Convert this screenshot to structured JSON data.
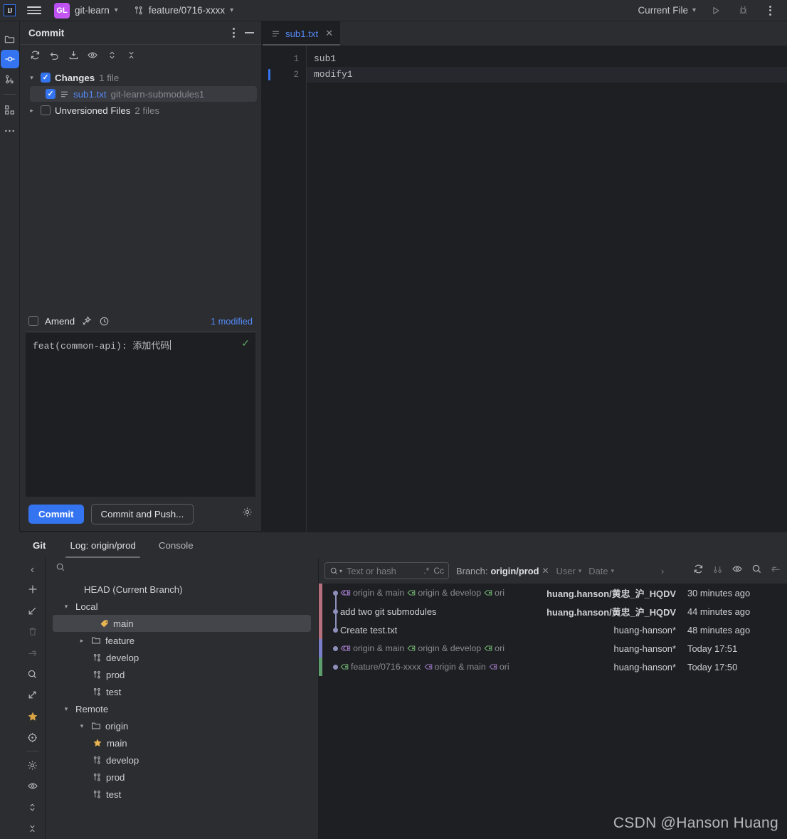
{
  "titlebar": {
    "logo": "IJ",
    "menu_icon": "hamburger-menu-icon",
    "project_badge": "GL",
    "project_name": "git-learn",
    "branch_icon": "git-branch-icon",
    "branch_name": "feature/0716-xxxx",
    "run_config": "Current File",
    "run_icon": "run-icon",
    "debug_icon": "debug-icon",
    "more_icon": "more-vertical-icon"
  },
  "left_stripe": {
    "items": [
      {
        "name": "project-tool-icon",
        "icon": "folder"
      },
      {
        "name": "commit-tool-icon",
        "icon": "commit",
        "active": true
      },
      {
        "name": "pull-requests-icon",
        "icon": "branch"
      },
      {
        "name": "structure-icon",
        "icon": "structure"
      },
      {
        "name": "more-tools-icon",
        "icon": "ellipsis"
      }
    ]
  },
  "commit_panel": {
    "title": "Commit",
    "options_icon": "more-vertical-icon",
    "minimize_icon": "minimize-icon",
    "toolbar": [
      {
        "name": "refresh-changes-icon"
      },
      {
        "name": "rollback-icon"
      },
      {
        "name": "shelve-icon"
      },
      {
        "name": "show-diff-icon"
      },
      {
        "name": "expand-collapse-icon"
      },
      {
        "name": "collapse-all-icon"
      }
    ],
    "tree": {
      "changes": {
        "label": "Changes",
        "count": "1 file",
        "checked": true,
        "expanded": true
      },
      "file": {
        "name": "sub1.txt",
        "path": "git-learn-submodules1",
        "checked": true,
        "selected": true,
        "icon": "text-file-icon"
      },
      "unversioned": {
        "label": "Unversioned Files",
        "count": "2 files",
        "checked": false,
        "expanded": false
      }
    },
    "amend": {
      "label": "Amend",
      "checked": false,
      "ai_icon": "ai-commit-message-icon",
      "history_icon": "commit-history-icon"
    },
    "modified_status": "1 modified",
    "message_value": "feat(common-api): 添加代码",
    "message_ok_icon": "check-icon",
    "commit_button": "Commit",
    "commit_push_button": "Commit and Push...",
    "settings_icon": "gear-icon"
  },
  "editor": {
    "tab": {
      "icon": "text-file-icon",
      "name": "sub1.txt",
      "close_icon": "close-icon"
    },
    "lines": [
      {
        "num": "1",
        "text": "sub1",
        "modified": false,
        "current": false
      },
      {
        "num": "2",
        "text": "modify1",
        "modified": true,
        "current": true
      }
    ]
  },
  "git_window": {
    "title": "Git",
    "tabs": [
      {
        "label": "Log: origin/prod",
        "active": true
      },
      {
        "label": "Console",
        "active": false
      }
    ],
    "side_icons": [
      {
        "name": "add-icon"
      },
      {
        "name": "checkout-icon"
      },
      {
        "name": "delete-icon",
        "dim": true
      },
      {
        "name": "rebase-icon",
        "dim": true
      },
      {
        "name": "search-icon"
      },
      {
        "name": "merge-icon"
      },
      {
        "name": "favorite-star-icon",
        "accent": "#d9a343"
      },
      {
        "name": "navigate-icon"
      },
      {
        "name": "settings-gear-icon"
      },
      {
        "name": "show-preview-icon"
      },
      {
        "name": "expand-all-icon"
      },
      {
        "name": "collapse-all-icon"
      }
    ],
    "branch_search_icon": "search-icon",
    "branch_tree": [
      {
        "label": "HEAD (Current Branch)",
        "indent": 1,
        "icon": "none",
        "twisty": ""
      },
      {
        "label": "Local",
        "indent": 0,
        "icon": "none",
        "twisty": "v"
      },
      {
        "label": "main",
        "indent": 2,
        "icon": "tag-yellow",
        "twisty": "",
        "selected": true
      },
      {
        "label": "feature",
        "indent": 1,
        "icon": "folder",
        "twisty": ">"
      },
      {
        "label": "develop",
        "indent": 2,
        "icon": "branch",
        "twisty": ""
      },
      {
        "label": "prod",
        "indent": 2,
        "icon": "branch",
        "twisty": ""
      },
      {
        "label": "test",
        "indent": 2,
        "icon": "branch",
        "twisty": ""
      },
      {
        "label": "Remote",
        "indent": 0,
        "icon": "none",
        "twisty": "v"
      },
      {
        "label": "origin",
        "indent": 1,
        "icon": "folder",
        "twisty": "v"
      },
      {
        "label": "main",
        "indent": 2,
        "icon": "star-yellow",
        "twisty": ""
      },
      {
        "label": "develop",
        "indent": 2,
        "icon": "branch",
        "twisty": ""
      },
      {
        "label": "prod",
        "indent": 2,
        "icon": "branch",
        "twisty": ""
      },
      {
        "label": "test",
        "indent": 2,
        "icon": "branch",
        "twisty": ""
      }
    ],
    "log_filters": {
      "search_icon": "search-dropdown-icon",
      "search_placeholder": "Text or hash",
      "regex_label": ".*",
      "case_label": "Cc",
      "branch_prefix": "Branch:",
      "branch_value": "origin/prod",
      "branch_clear_icon": "close-icon",
      "user_label": "User",
      "date_label": "Date",
      "expand_icon": "chevron-right-icon",
      "right_icons": [
        {
          "name": "refresh-log-icon"
        },
        {
          "name": "show-graph-icon",
          "dim": true
        },
        {
          "name": "show-details-icon"
        },
        {
          "name": "find-icon"
        },
        {
          "name": "hide-window-icon",
          "dim": true
        }
      ]
    },
    "log_rows": [
      {
        "edge_color": "#b5707d",
        "tags": [
          "origin & main",
          "origin & develop",
          "ori"
        ],
        "subject": "",
        "author": "huang.hanson/黄忠_沪_HQDV",
        "author_bold": true,
        "date": "30 minutes ago",
        "line_up": false,
        "line_down": true
      },
      {
        "edge_color": "#b5707d",
        "tags": [],
        "subject": "add two git submodules",
        "author": "huang.hanson/黄忠_沪_HQDV",
        "author_bold": true,
        "date": "44 minutes ago",
        "line_up": true,
        "line_down": true
      },
      {
        "edge_color": "#b5707d",
        "tags": [],
        "subject": "Create test.txt",
        "author": "huang-hanson*",
        "author_bold": false,
        "date": "48 minutes ago",
        "line_up": true,
        "line_down": false
      },
      {
        "edge_color": "#7a7ecb",
        "tags": [
          "origin & main",
          "origin & develop",
          "ori"
        ],
        "subject": "",
        "author": "huang-hanson*",
        "author_bold": false,
        "date": "Today 17:51",
        "line_up": false,
        "line_down": false
      },
      {
        "edge_color": "#5e9e6c",
        "tags": [
          "feature/0716-xxxx",
          "origin & main",
          "ori"
        ],
        "subject": "",
        "author": "huang-hanson*",
        "author_bold": false,
        "date": "Today 17:50",
        "line_up": false,
        "line_down": false
      }
    ]
  },
  "watermark": "CSDN @Hanson Huang",
  "colors": {
    "accent_blue": "#3574f0",
    "link_blue": "#548af7",
    "panel_bg": "#2b2d30",
    "editor_bg": "#1e1f22",
    "text": "#dfe1e5",
    "muted": "#868a91",
    "star_yellow": "#d9a343",
    "check_green": "#5fad65"
  }
}
